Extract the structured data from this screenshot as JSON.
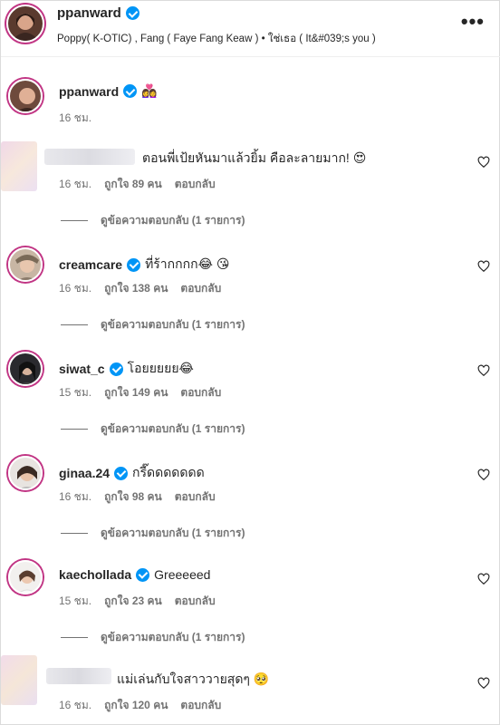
{
  "header": {
    "username": "ppanward",
    "subtitle": "Poppy( K-OTIC) , Fang ( Faye Fang Keaw ) • ใช่เธอ ( It&#039;s you )",
    "more": "•••"
  },
  "caption": {
    "username": "ppanward",
    "text": "👩‍❤️‍👩",
    "time": "16 ชม."
  },
  "comments": [
    {
      "username": "",
      "verified": false,
      "text": "ตอนพี่เป้ยหันมาแล้วยิ้ม คือละลายมาก! 😍",
      "time": "16 ชม.",
      "likes": "ถูกใจ 89 คน",
      "reply": "ตอบกลับ",
      "view_replies": "ดูข้อความตอบกลับ (1 รายการ)"
    },
    {
      "username": "creamcare",
      "verified": true,
      "text": "ที่ร้ากกกก😂 😘",
      "time": "16 ชม.",
      "likes": "ถูกใจ 138 คน",
      "reply": "ตอบกลับ",
      "view_replies": "ดูข้อความตอบกลับ (1 รายการ)"
    },
    {
      "username": "siwat_c",
      "verified": true,
      "text": "โอยยยยย😂",
      "time": "15 ชม.",
      "likes": "ถูกใจ 149 คน",
      "reply": "ตอบกลับ",
      "view_replies": "ดูข้อความตอบกลับ (1 รายการ)"
    },
    {
      "username": "ginaa.24",
      "verified": true,
      "text": "กรี๊ดดดดดดด",
      "time": "16 ชม.",
      "likes": "ถูกใจ 98 คน",
      "reply": "ตอบกลับ",
      "view_replies": "ดูข้อความตอบกลับ (1 รายการ)"
    },
    {
      "username": "kaechollada",
      "verified": true,
      "text": "Greeeeed",
      "time": "15 ชม.",
      "likes": "ถูกใจ 23 คน",
      "reply": "ตอบกลับ",
      "view_replies": "ดูข้อความตอบกลับ (1 รายการ)"
    },
    {
      "username": "",
      "verified": false,
      "text": "แม่เล่นกับใจสาววายสุดๆ 🥺",
      "time": "16 ชม.",
      "likes": "ถูกใจ 120 คน",
      "reply": "ตอบกลับ"
    }
  ]
}
